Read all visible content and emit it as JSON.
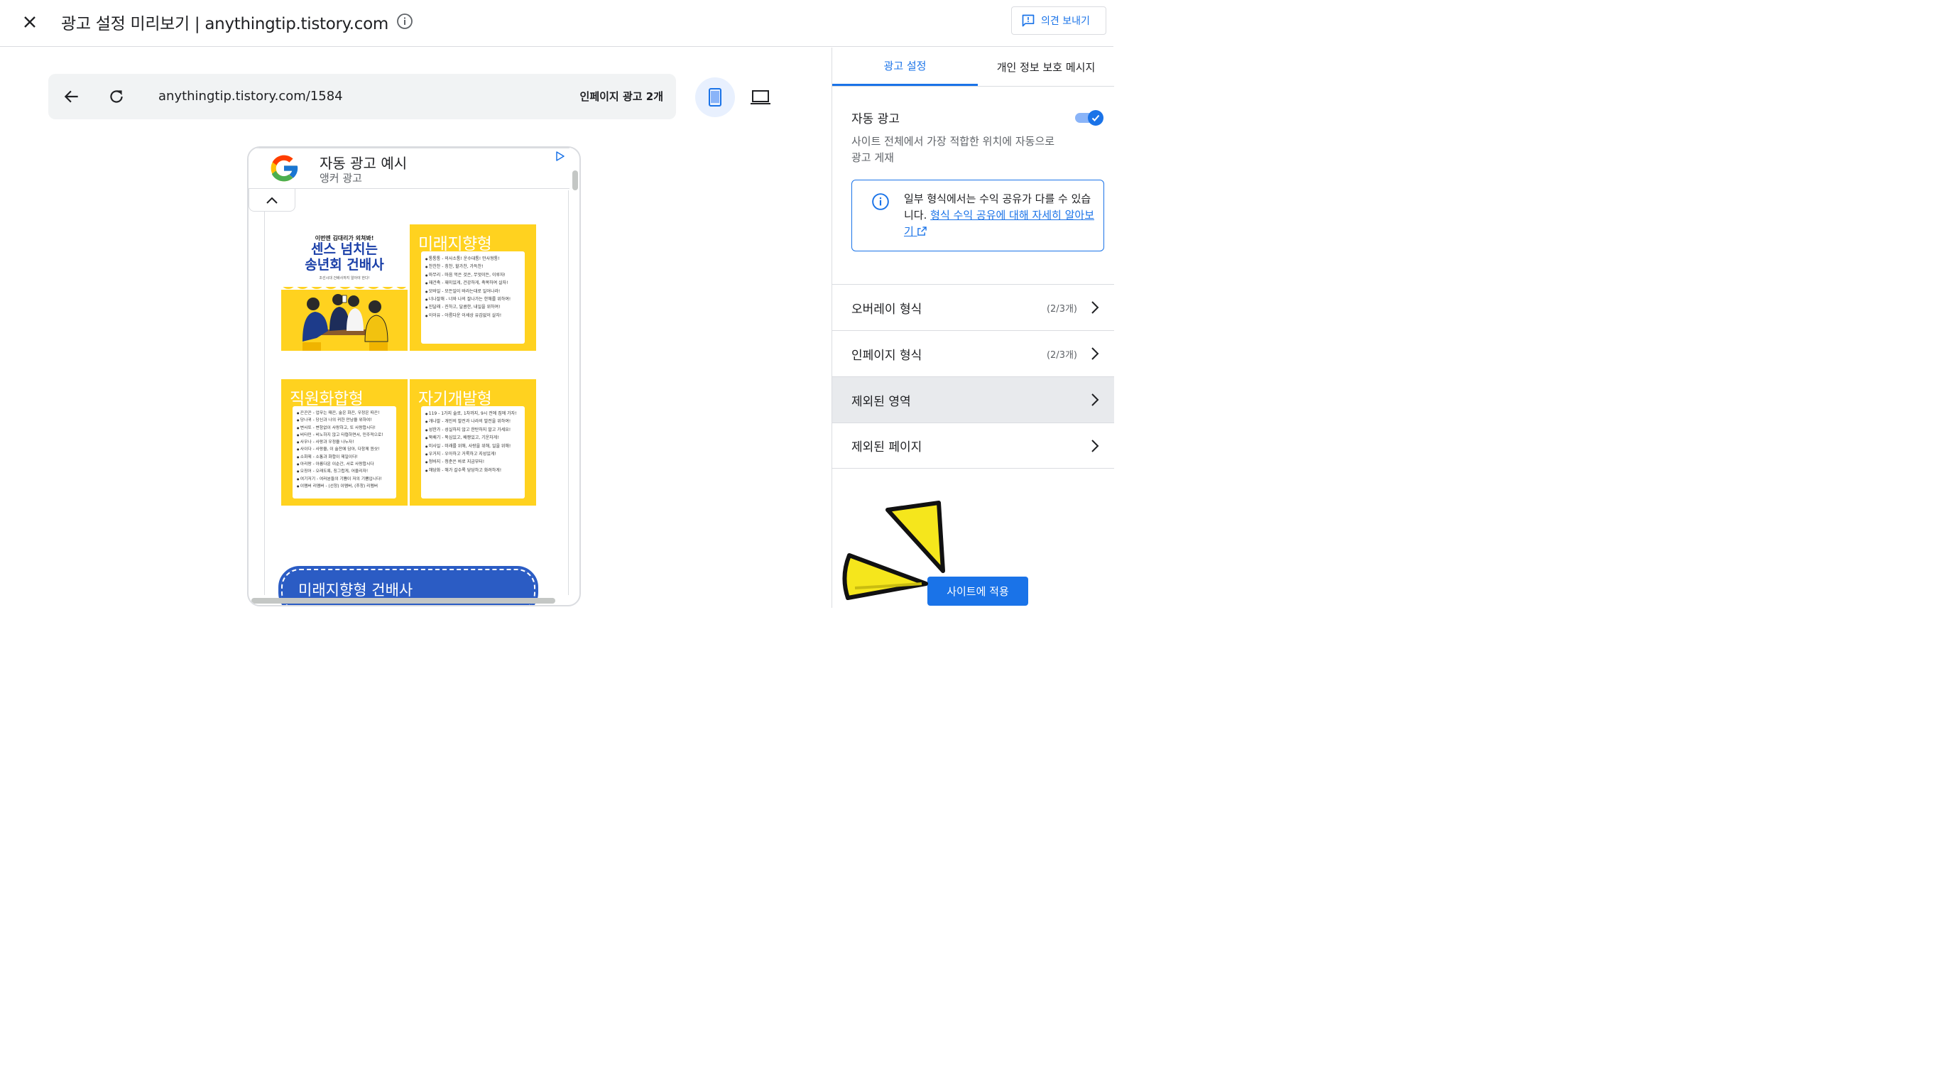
{
  "header": {
    "title": "광고 설정 미리보기 | anythingtip.tistory.com",
    "feedback_label": "의견 보내기"
  },
  "browser": {
    "url": "anythingtip.tistory.com/1584",
    "ad_count": "인페이지 광고 2개"
  },
  "preview": {
    "anchor_ad": {
      "title": "자동 광고 예시",
      "subtitle": "앵커 광고"
    },
    "thumbnails": [
      {
        "kicker": "이번엔 김대리가 외쳐봐!",
        "title_line1": "센스 넘치는",
        "title_line2": "송년회 건배사",
        "small": "조선시대 건배사까지 알아야 한다!"
      },
      {
        "header": "미래지향형",
        "lines": [
          "통통통 - 의사소통! 운수대통! 만사형통!",
          "찬찬찬 - 칭찬, 할가찬, 가득찬!",
          "마무리 - 마음 먹은 것은, 무엇이든, 이루자!",
          "재건축 - 재미있게, 건강하게, 축복하여 살자!",
          "모바일 - 모든일이 바라는대로 일어나라!",
          "너나잘해 - 너와 나의 잘나가는 한해를 위하여!",
          "진달래 - 진하고, 달콤한, 내일을 위하여!",
          "이이유 - 아름다운 이세상 유감없이 살자!"
        ]
      },
      {
        "header": "직원화합형",
        "lines": [
          "끈끈끈 - 업무는 때끈, 술은 화끈, 우정은 따끈!",
          "당나귀 - 당신과 나의 귀한 만남을 위하여!",
          "변사또 - 변함없이 사랑하고, 또 사랑합시다!",
          "비타민 - 비노하지 않고 타협하면서, 민주적으로!",
          "사우나 - 사랑과 우정을 나누자!",
          "사이다 - 사랑을, 이 술잔에 담아, 다함께 원샷!",
          "소화제 - 소통과 화합이 제일이다!",
          "아리랑 - 아름다운 이순간, 서로 사랑합시다",
          "오징어 - 오래도록, 징그럽게, 어울리자!",
          "여기저기 - 여러분들의 기쁨이 저의 기쁨입니다!",
          "이멤버 리멤버 - (선창) 이멤버, (후창) 리멤버"
        ]
      },
      {
        "header": "자기개발형",
        "lines": [
          "119 - 1가지 술로, 1차까지, 9시 전에 집에 가자!",
          "개나발 - 개인의 발전과 나라의 발전을 위하여!",
          "성한가 - 성실하지 않고 한탄하지 말고 가세요!",
          "뚝배기 - 뚝심있고, 배짱있고, 기운차게!",
          "미사일 - 미래를 위해, 사랑을 위해, 일을 위해!",
          "우거지 - 우아하고 거룩하고 지성있게!",
          "청바지 - 청춘은 바로 지금부터!",
          "해당화 - 해가 갈수록 당당하고 화려하게!"
        ]
      }
    ],
    "bottom_banner": "미래지향형 건배사"
  },
  "panel": {
    "tabs": [
      "광고 설정",
      "개인 정보 보호 메시지"
    ],
    "auto_ads": {
      "title": "자동 광고",
      "enabled": true,
      "description": "사이트 전체에서 가장 적합한 위치에 자동으로 광고 게재"
    },
    "info": {
      "text": "일부 형식에서는 수익 공유가 다를 수 있습니다.",
      "link": "형식 수익 공유에 대해 자세히 알아보기"
    },
    "rows": [
      {
        "label": "오버레이 형식",
        "count": "(2/3개)"
      },
      {
        "label": "인페이지 형식",
        "count": "(2/3개)"
      },
      {
        "label": "제외된 영역",
        "count": ""
      },
      {
        "label": "제외된 페이지",
        "count": ""
      }
    ],
    "apply_label": "사이트에 적용"
  },
  "colors": {
    "accent": "#1a73e8",
    "thumb_yellow": "#ffd21f",
    "banner_blue": "#2b5cc4",
    "pointer_yellow": "#f5e61c"
  }
}
